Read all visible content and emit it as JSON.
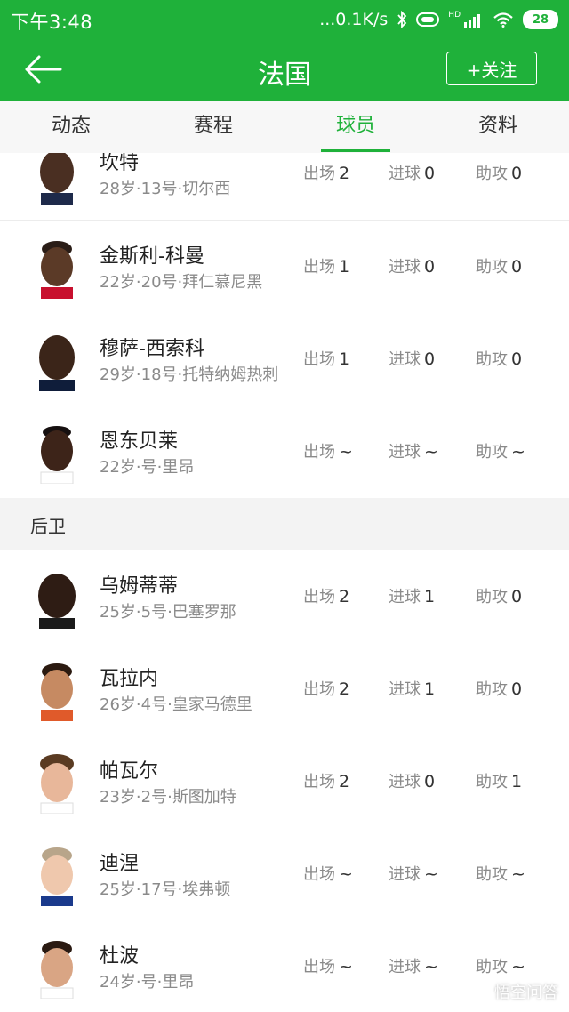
{
  "status_bar": {
    "time": "下午3:48",
    "network": "...0.1K/s",
    "signal_label": "HD",
    "battery": "28"
  },
  "app_bar": {
    "title": "法国",
    "follow_label": "+关注"
  },
  "tabs": [
    {
      "label": "动态",
      "active": false
    },
    {
      "label": "赛程",
      "active": false
    },
    {
      "label": "球员",
      "active": true
    },
    {
      "label": "资料",
      "active": false
    }
  ],
  "stat_labels": {
    "apps": "出场",
    "goals": "进球",
    "assists": "助攻"
  },
  "players_top": [
    {
      "name": "坎特",
      "meta": "28岁·13号·切尔西",
      "apps": "2",
      "goals": "0",
      "assists": "0"
    },
    {
      "name": "金斯利-科曼",
      "meta": "22岁·20号·拜仁慕尼黑",
      "apps": "1",
      "goals": "0",
      "assists": "0"
    },
    {
      "name": "穆萨-西索科",
      "meta": "29岁·18号·托特纳姆热刺",
      "apps": "1",
      "goals": "0",
      "assists": "0"
    },
    {
      "name": "恩东贝莱",
      "meta": "22岁·号·里昂",
      "apps": "~",
      "goals": "~",
      "assists": "~"
    }
  ],
  "section_defenders": "后卫",
  "players_def": [
    {
      "name": "乌姆蒂蒂",
      "meta": "25岁·5号·巴塞罗那",
      "apps": "2",
      "goals": "1",
      "assists": "0"
    },
    {
      "name": "瓦拉内",
      "meta": "26岁·4号·皇家马德里",
      "apps": "2",
      "goals": "1",
      "assists": "0"
    },
    {
      "name": "帕瓦尔",
      "meta": "23岁·2号·斯图加特",
      "apps": "2",
      "goals": "0",
      "assists": "1"
    },
    {
      "name": "迪涅",
      "meta": "25岁·17号·埃弗顿",
      "apps": "~",
      "goals": "~",
      "assists": "~"
    },
    {
      "name": "杜波",
      "meta": "24岁·号·里昂",
      "apps": "~",
      "goals": "~",
      "assists": "~"
    }
  ],
  "watermark": "悟空问答",
  "colors": {
    "brand": "#1fb13a"
  }
}
